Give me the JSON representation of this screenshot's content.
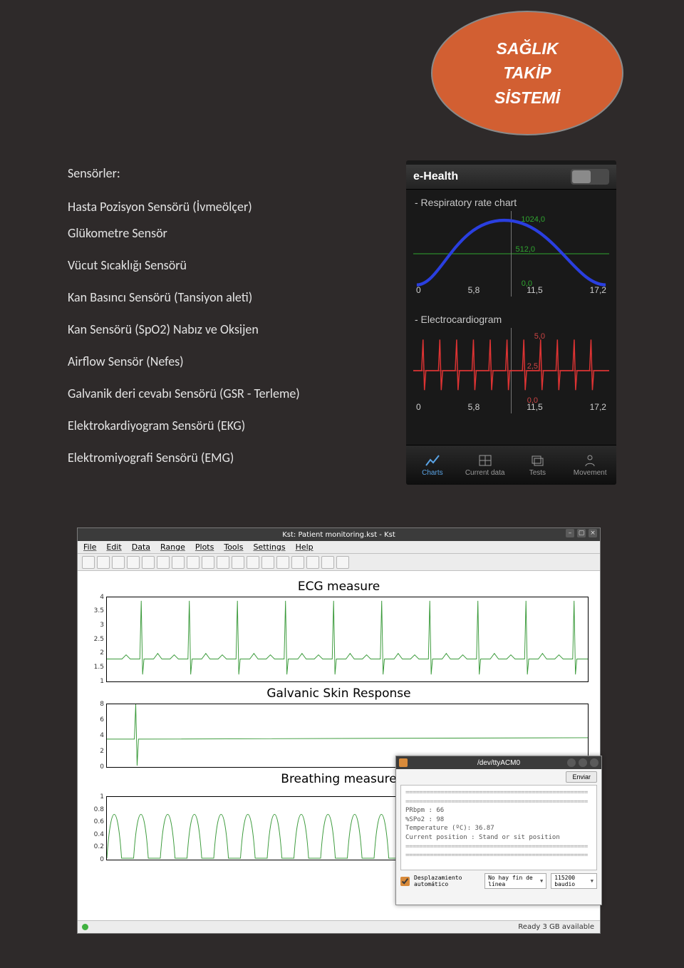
{
  "badge": {
    "line1": "SAĞLIK",
    "line2": "TAKİP",
    "line3": "SİSTEMİ"
  },
  "left": {
    "heading": "Sensörler:",
    "items": [
      "Hasta Pozisyon Sensörü (İvmeölçer)",
      "Glükometre Sensör",
      "Vücut Sıcaklığı Sensörü",
      "Kan Basıncı Sensörü (Tansiyon aleti)",
      "Kan Sensörü (SpO2) Nabız ve Oksijen",
      "Airflow Sensör (Nefes)",
      "Galvanik deri cevabı Sensörü (GSR - Terleme)",
      "Elektrokardiyogram Sensörü (EKG)",
      "Elektromiyografi Sensörü (EMG)"
    ]
  },
  "phone": {
    "app_title": "e-Health",
    "section1": "- Respiratory rate chart",
    "section2": "- Electrocardiogram",
    "xticks": [
      "0",
      "5,8",
      "11,5",
      "17,2"
    ],
    "resp_yticks": {
      "top": "1024,0",
      "mid": "512,0",
      "bot": "0,0"
    },
    "ecg_yticks": {
      "top": "5,0",
      "mid": "2,5",
      "bot": "0,0"
    },
    "tabs": [
      {
        "label": "Charts",
        "icon": "chart-icon"
      },
      {
        "label": "Current data",
        "icon": "grid-icon"
      },
      {
        "label": "Tests",
        "icon": "layers-icon"
      },
      {
        "label": "Movement",
        "icon": "person-icon"
      }
    ]
  },
  "kst": {
    "title": "Kst: Patient monitoring.kst - Kst",
    "menu": [
      "File",
      "Edit",
      "Data",
      "Range",
      "Plots",
      "Tools",
      "Settings",
      "Help"
    ],
    "plots": {
      "ecg": {
        "title": "ECG measure",
        "ylabels": [
          "4",
          "3.5",
          "3",
          "2.5",
          "2",
          "1.5",
          "1"
        ]
      },
      "gsr": {
        "title": "Galvanic Skin Response",
        "ylabels": [
          "8",
          "6",
          "4",
          "2",
          "0"
        ]
      },
      "breath": {
        "title": "Breathing measure",
        "ylabels": [
          "1",
          "0.8",
          "0.6",
          "0.4",
          "0.2",
          "0"
        ]
      }
    },
    "status": "Ready  3 GB available"
  },
  "terminal": {
    "title": "/dev/ttyACM0",
    "send_button": "Enviar",
    "lines": [
      "PRbpm : 66",
      "%SPo2 : 98",
      "Temperature (ºC): 36.87",
      "Current position : Stand or sit position"
    ],
    "autoscroll_label": "Desplazamiento automático",
    "lineend": "No hay fin de línea",
    "baud": "115200 baudio"
  },
  "chart_data": [
    {
      "type": "line",
      "title": "Respiratory rate chart",
      "x": [
        0,
        5.8,
        11.5,
        17.2
      ],
      "ylim": [
        0,
        1024
      ],
      "series": [
        {
          "name": "respiratory",
          "values_approx": "smooth hump rising near 1024 at ~8 then falling"
        }
      ]
    },
    {
      "type": "line",
      "title": "Electrocardiogram",
      "x": [
        0,
        5.8,
        11.5,
        17.2
      ],
      "ylim": [
        0,
        5
      ],
      "series": [
        {
          "name": "ecg",
          "values_approx": "periodic spikes ~5 at roughly 1s intervals baseline ~2.5"
        }
      ]
    },
    {
      "type": "line",
      "title": "ECG measure",
      "ylim": [
        1,
        4
      ],
      "series": [
        {
          "name": "ecg_measure",
          "values_approx": "10 QRS complexes baseline ~1.7 peaks ~4"
        }
      ]
    },
    {
      "type": "line",
      "title": "Galvanic Skin Response",
      "ylim": [
        0,
        8
      ],
      "series": [
        {
          "name": "gsr",
          "values_approx": "one spike to ~9 near start then flat ~4"
        }
      ]
    },
    {
      "type": "line",
      "title": "Breathing measure",
      "ylim": [
        0,
        1
      ],
      "series": [
        {
          "name": "breathing",
          "values_approx": "~18 rounded pulses 0→1"
        }
      ]
    }
  ]
}
